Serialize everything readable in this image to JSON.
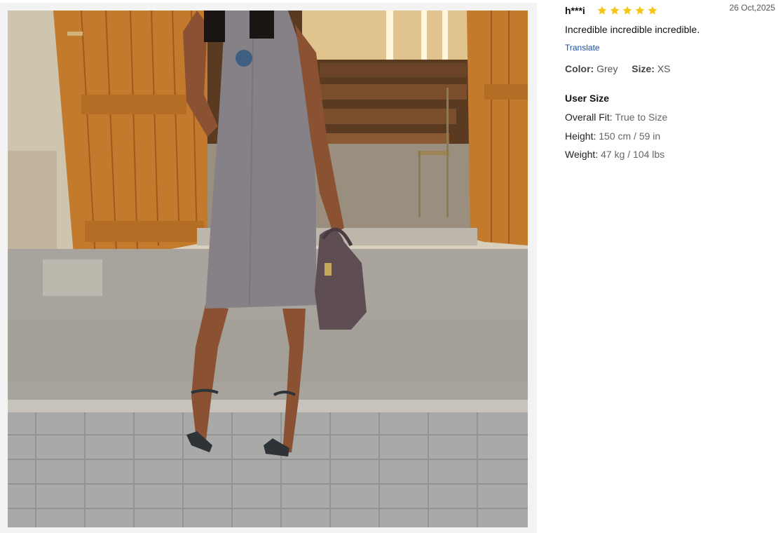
{
  "review": {
    "reviewer_name": "h***i",
    "rating": 5,
    "date": "26 Oct,2025",
    "comment": "Incredible incredible incredible.",
    "translate_label": "Translate",
    "color_label": "Color:",
    "color_value": "Grey",
    "size_label": "Size:",
    "size_value": "XS",
    "user_size_title": "User Size",
    "overall_fit_label": "Overall Fit:",
    "overall_fit_value": "True to Size",
    "height_label": "Height:",
    "height_value": "150 cm / 59 in",
    "weight_label": "Weight:",
    "weight_value": "47 kg / 104 lbs"
  },
  "photo": {
    "description_icon": "review-photo"
  },
  "colors": {
    "star": "#f5c518",
    "link": "#1a4e9c"
  }
}
